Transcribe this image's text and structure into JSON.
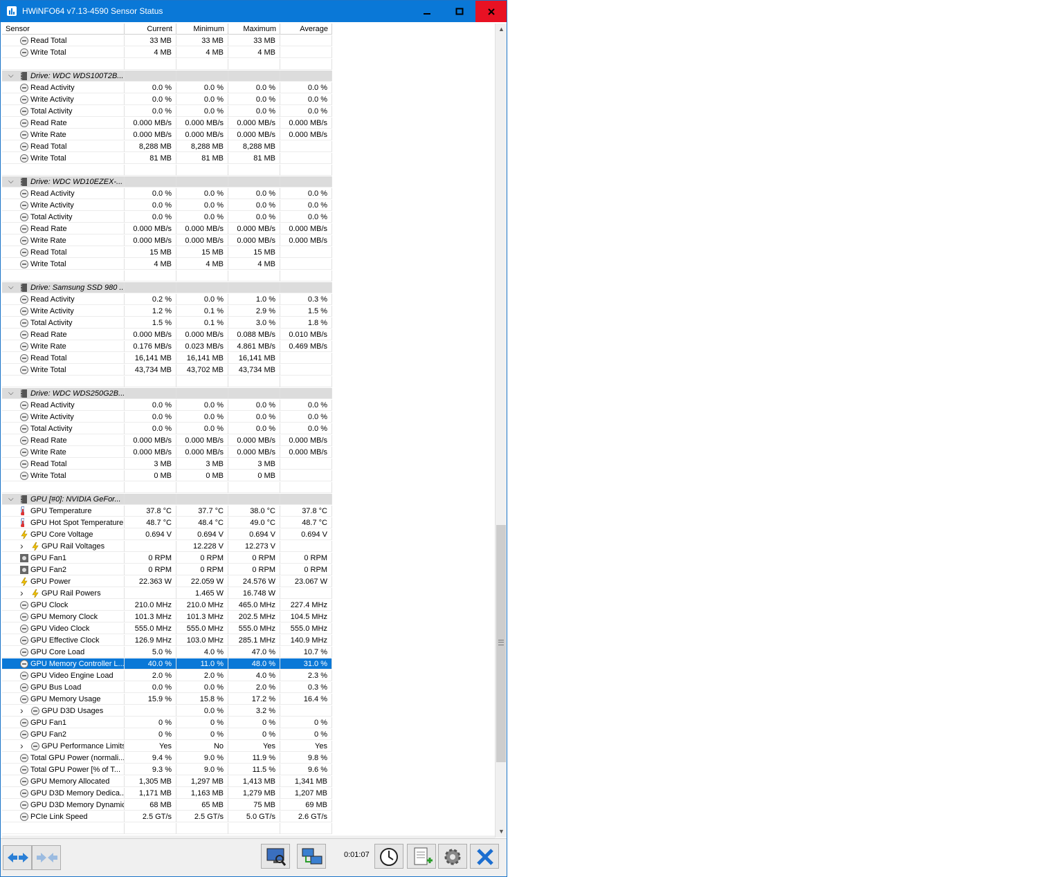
{
  "window": {
    "title": "HWiNFO64 v7.13-4590 Sensor Status"
  },
  "columns": {
    "sensor": "Sensor",
    "current": "Current",
    "minimum": "Minimum",
    "maximum": "Maximum",
    "average": "Average"
  },
  "rows": [
    {
      "type": "item",
      "icon": "circle-gauge-icon",
      "label": "Read Total",
      "cur": "33 MB",
      "min": "33 MB",
      "max": "33 MB",
      "avg": ""
    },
    {
      "type": "item",
      "icon": "circle-gauge-icon",
      "label": "Write Total",
      "cur": "4 MB",
      "min": "4 MB",
      "max": "4 MB",
      "avg": ""
    },
    {
      "type": "blank"
    },
    {
      "type": "group",
      "icon": "drive-icon",
      "label": "Drive: WDC  WDS100T2B..."
    },
    {
      "type": "item",
      "icon": "circle-gauge-icon",
      "label": "Read Activity",
      "cur": "0.0 %",
      "min": "0.0 %",
      "max": "0.0 %",
      "avg": "0.0 %"
    },
    {
      "type": "item",
      "icon": "circle-gauge-icon",
      "label": "Write Activity",
      "cur": "0.0 %",
      "min": "0.0 %",
      "max": "0.0 %",
      "avg": "0.0 %"
    },
    {
      "type": "item",
      "icon": "circle-gauge-icon",
      "label": "Total Activity",
      "cur": "0.0 %",
      "min": "0.0 %",
      "max": "0.0 %",
      "avg": "0.0 %"
    },
    {
      "type": "item",
      "icon": "circle-gauge-icon",
      "label": "Read Rate",
      "cur": "0.000 MB/s",
      "min": "0.000 MB/s",
      "max": "0.000 MB/s",
      "avg": "0.000 MB/s"
    },
    {
      "type": "item",
      "icon": "circle-gauge-icon",
      "label": "Write Rate",
      "cur": "0.000 MB/s",
      "min": "0.000 MB/s",
      "max": "0.000 MB/s",
      "avg": "0.000 MB/s"
    },
    {
      "type": "item",
      "icon": "circle-gauge-icon",
      "label": "Read Total",
      "cur": "8,288 MB",
      "min": "8,288 MB",
      "max": "8,288 MB",
      "avg": ""
    },
    {
      "type": "item",
      "icon": "circle-gauge-icon",
      "label": "Write Total",
      "cur": "81 MB",
      "min": "81 MB",
      "max": "81 MB",
      "avg": ""
    },
    {
      "type": "blank"
    },
    {
      "type": "group",
      "icon": "drive-icon",
      "label": "Drive: WDC WD10EZEX-..."
    },
    {
      "type": "item",
      "icon": "circle-gauge-icon",
      "label": "Read Activity",
      "cur": "0.0 %",
      "min": "0.0 %",
      "max": "0.0 %",
      "avg": "0.0 %"
    },
    {
      "type": "item",
      "icon": "circle-gauge-icon",
      "label": "Write Activity",
      "cur": "0.0 %",
      "min": "0.0 %",
      "max": "0.0 %",
      "avg": "0.0 %"
    },
    {
      "type": "item",
      "icon": "circle-gauge-icon",
      "label": "Total Activity",
      "cur": "0.0 %",
      "min": "0.0 %",
      "max": "0.0 %",
      "avg": "0.0 %"
    },
    {
      "type": "item",
      "icon": "circle-gauge-icon",
      "label": "Read Rate",
      "cur": "0.000 MB/s",
      "min": "0.000 MB/s",
      "max": "0.000 MB/s",
      "avg": "0.000 MB/s"
    },
    {
      "type": "item",
      "icon": "circle-gauge-icon",
      "label": "Write Rate",
      "cur": "0.000 MB/s",
      "min": "0.000 MB/s",
      "max": "0.000 MB/s",
      "avg": "0.000 MB/s"
    },
    {
      "type": "item",
      "icon": "circle-gauge-icon",
      "label": "Read Total",
      "cur": "15 MB",
      "min": "15 MB",
      "max": "15 MB",
      "avg": ""
    },
    {
      "type": "item",
      "icon": "circle-gauge-icon",
      "label": "Write Total",
      "cur": "4 MB",
      "min": "4 MB",
      "max": "4 MB",
      "avg": ""
    },
    {
      "type": "blank"
    },
    {
      "type": "group",
      "icon": "drive-icon",
      "label": "Drive: Samsung SSD 980 ..."
    },
    {
      "type": "item",
      "icon": "circle-gauge-icon",
      "label": "Read Activity",
      "cur": "0.2 %",
      "min": "0.0 %",
      "max": "1.0 %",
      "avg": "0.3 %"
    },
    {
      "type": "item",
      "icon": "circle-gauge-icon",
      "label": "Write Activity",
      "cur": "1.2 %",
      "min": "0.1 %",
      "max": "2.9 %",
      "avg": "1.5 %"
    },
    {
      "type": "item",
      "icon": "circle-gauge-icon",
      "label": "Total Activity",
      "cur": "1.5 %",
      "min": "0.1 %",
      "max": "3.0 %",
      "avg": "1.8 %"
    },
    {
      "type": "item",
      "icon": "circle-gauge-icon",
      "label": "Read Rate",
      "cur": "0.000 MB/s",
      "min": "0.000 MB/s",
      "max": "0.088 MB/s",
      "avg": "0.010 MB/s"
    },
    {
      "type": "item",
      "icon": "circle-gauge-icon",
      "label": "Write Rate",
      "cur": "0.176 MB/s",
      "min": "0.023 MB/s",
      "max": "4.861 MB/s",
      "avg": "0.469 MB/s"
    },
    {
      "type": "item",
      "icon": "circle-gauge-icon",
      "label": "Read Total",
      "cur": "16,141 MB",
      "min": "16,141 MB",
      "max": "16,141 MB",
      "avg": ""
    },
    {
      "type": "item",
      "icon": "circle-gauge-icon",
      "label": "Write Total",
      "cur": "43,734 MB",
      "min": "43,702 MB",
      "max": "43,734 MB",
      "avg": ""
    },
    {
      "type": "blank"
    },
    {
      "type": "group",
      "icon": "drive-icon",
      "label": "Drive: WDC WDS250G2B..."
    },
    {
      "type": "item",
      "icon": "circle-gauge-icon",
      "label": "Read Activity",
      "cur": "0.0 %",
      "min": "0.0 %",
      "max": "0.0 %",
      "avg": "0.0 %"
    },
    {
      "type": "item",
      "icon": "circle-gauge-icon",
      "label": "Write Activity",
      "cur": "0.0 %",
      "min": "0.0 %",
      "max": "0.0 %",
      "avg": "0.0 %"
    },
    {
      "type": "item",
      "icon": "circle-gauge-icon",
      "label": "Total Activity",
      "cur": "0.0 %",
      "min": "0.0 %",
      "max": "0.0 %",
      "avg": "0.0 %"
    },
    {
      "type": "item",
      "icon": "circle-gauge-icon",
      "label": "Read Rate",
      "cur": "0.000 MB/s",
      "min": "0.000 MB/s",
      "max": "0.000 MB/s",
      "avg": "0.000 MB/s"
    },
    {
      "type": "item",
      "icon": "circle-gauge-icon",
      "label": "Write Rate",
      "cur": "0.000 MB/s",
      "min": "0.000 MB/s",
      "max": "0.000 MB/s",
      "avg": "0.000 MB/s"
    },
    {
      "type": "item",
      "icon": "circle-gauge-icon",
      "label": "Read Total",
      "cur": "3 MB",
      "min": "3 MB",
      "max": "3 MB",
      "avg": ""
    },
    {
      "type": "item",
      "icon": "circle-gauge-icon",
      "label": "Write Total",
      "cur": "0 MB",
      "min": "0 MB",
      "max": "0 MB",
      "avg": ""
    },
    {
      "type": "blank"
    },
    {
      "type": "group",
      "icon": "gpu-chip-icon",
      "label": "GPU [#0]: NVIDIA GeFor..."
    },
    {
      "type": "item",
      "icon": "thermometer-icon",
      "label": "GPU Temperature",
      "cur": "37.8 °C",
      "min": "37.7 °C",
      "max": "38.0 °C",
      "avg": "37.8 °C"
    },
    {
      "type": "item",
      "icon": "thermometer-icon",
      "label": "GPU Hot Spot Temperature",
      "cur": "48.7 °C",
      "min": "48.4 °C",
      "max": "49.0 °C",
      "avg": "48.7 °C"
    },
    {
      "type": "item",
      "icon": "lightning-icon",
      "label": "GPU Core Voltage",
      "cur": "0.694 V",
      "min": "0.694 V",
      "max": "0.694 V",
      "avg": "0.694 V"
    },
    {
      "type": "sub",
      "icon": "lightning-icon",
      "label": "GPU Rail Voltages",
      "cur": "",
      "min": "12.228 V",
      "max": "12.273 V",
      "avg": ""
    },
    {
      "type": "item",
      "icon": "fan-icon",
      "label": "GPU Fan1",
      "cur": "0 RPM",
      "min": "0 RPM",
      "max": "0 RPM",
      "avg": "0 RPM"
    },
    {
      "type": "item",
      "icon": "fan-icon",
      "label": "GPU Fan2",
      "cur": "0 RPM",
      "min": "0 RPM",
      "max": "0 RPM",
      "avg": "0 RPM"
    },
    {
      "type": "item",
      "icon": "lightning-icon",
      "label": "GPU Power",
      "cur": "22.363 W",
      "min": "22.059 W",
      "max": "24.576 W",
      "avg": "23.067 W"
    },
    {
      "type": "sub",
      "icon": "lightning-icon",
      "label": "GPU Rail Powers",
      "cur": "",
      "min": "1.465 W",
      "max": "16.748 W",
      "avg": ""
    },
    {
      "type": "item",
      "icon": "circle-gauge-icon",
      "label": "GPU Clock",
      "cur": "210.0 MHz",
      "min": "210.0 MHz",
      "max": "465.0 MHz",
      "avg": "227.4 MHz"
    },
    {
      "type": "item",
      "icon": "circle-gauge-icon",
      "label": "GPU Memory Clock",
      "cur": "101.3 MHz",
      "min": "101.3 MHz",
      "max": "202.5 MHz",
      "avg": "104.5 MHz"
    },
    {
      "type": "item",
      "icon": "circle-gauge-icon",
      "label": "GPU Video Clock",
      "cur": "555.0 MHz",
      "min": "555.0 MHz",
      "max": "555.0 MHz",
      "avg": "555.0 MHz"
    },
    {
      "type": "item",
      "icon": "circle-gauge-icon",
      "label": "GPU Effective Clock",
      "cur": "126.9 MHz",
      "min": "103.0 MHz",
      "max": "285.1 MHz",
      "avg": "140.9 MHz"
    },
    {
      "type": "item",
      "icon": "circle-gauge-icon",
      "label": "GPU Core Load",
      "cur": "5.0 %",
      "min": "4.0 %",
      "max": "47.0 %",
      "avg": "10.7 %"
    },
    {
      "type": "item",
      "icon": "circle-gauge-icon",
      "label": "GPU Memory Controller L...",
      "cur": "40.0 %",
      "min": "11.0 %",
      "max": "48.0 %",
      "avg": "31.0 %",
      "selected": true
    },
    {
      "type": "item",
      "icon": "circle-gauge-icon",
      "label": "GPU Video Engine Load",
      "cur": "2.0 %",
      "min": "2.0 %",
      "max": "4.0 %",
      "avg": "2.3 %"
    },
    {
      "type": "item",
      "icon": "circle-gauge-icon",
      "label": "GPU Bus Load",
      "cur": "0.0 %",
      "min": "0.0 %",
      "max": "2.0 %",
      "avg": "0.3 %"
    },
    {
      "type": "item",
      "icon": "circle-gauge-icon",
      "label": "GPU Memory Usage",
      "cur": "15.9 %",
      "min": "15.8 %",
      "max": "17.2 %",
      "avg": "16.4 %"
    },
    {
      "type": "sub",
      "icon": "circle-gauge-icon",
      "label": "GPU D3D Usages",
      "cur": "",
      "min": "0.0 %",
      "max": "3.2 %",
      "avg": ""
    },
    {
      "type": "item",
      "icon": "circle-gauge-icon",
      "label": "GPU Fan1",
      "cur": "0 %",
      "min": "0 %",
      "max": "0 %",
      "avg": "0 %"
    },
    {
      "type": "item",
      "icon": "circle-gauge-icon",
      "label": "GPU Fan2",
      "cur": "0 %",
      "min": "0 %",
      "max": "0 %",
      "avg": "0 %"
    },
    {
      "type": "sub",
      "icon": "circle-gauge-icon",
      "label": "GPU Performance Limits",
      "cur": "Yes",
      "min": "No",
      "max": "Yes",
      "avg": "Yes"
    },
    {
      "type": "item",
      "icon": "circle-gauge-icon",
      "label": "Total GPU Power (normali...",
      "cur": "9.4 %",
      "min": "9.0 %",
      "max": "11.9 %",
      "avg": "9.8 %"
    },
    {
      "type": "item",
      "icon": "circle-gauge-icon",
      "label": "Total GPU Power [% of T...",
      "cur": "9.3 %",
      "min": "9.0 %",
      "max": "11.5 %",
      "avg": "9.6 %"
    },
    {
      "type": "item",
      "icon": "circle-gauge-icon",
      "label": "GPU Memory Allocated",
      "cur": "1,305 MB",
      "min": "1,297 MB",
      "max": "1,413 MB",
      "avg": "1,341 MB"
    },
    {
      "type": "item",
      "icon": "circle-gauge-icon",
      "label": "GPU D3D Memory Dedica...",
      "cur": "1,171 MB",
      "min": "1,163 MB",
      "max": "1,279 MB",
      "avg": "1,207 MB"
    },
    {
      "type": "item",
      "icon": "circle-gauge-icon",
      "label": "GPU D3D Memory Dynamic",
      "cur": "68 MB",
      "min": "65 MB",
      "max": "75 MB",
      "avg": "69 MB"
    },
    {
      "type": "item",
      "icon": "circle-gauge-icon",
      "label": "PCIe Link Speed",
      "cur": "2.5 GT/s",
      "min": "2.5 GT/s",
      "max": "5.0 GT/s",
      "avg": "2.6 GT/s"
    },
    {
      "type": "blank"
    }
  ],
  "toolbar": {
    "timer": "0:01:07"
  },
  "colors": {
    "title_bar": "#0a78d7",
    "selection": "#0a78d7",
    "close_hover": "#e81123",
    "group_row": "#dcdcdc"
  }
}
